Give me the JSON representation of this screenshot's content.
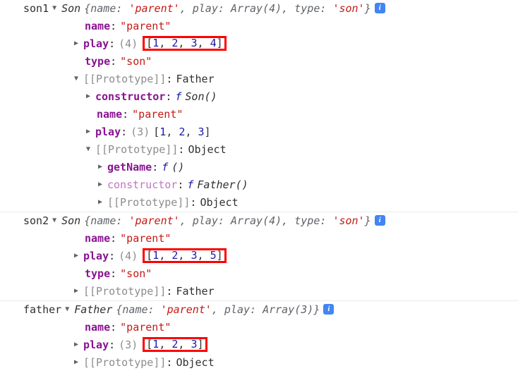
{
  "console": {
    "title": "devtools-console-object-inspector",
    "colors": {
      "key_own": "#881391",
      "key_proto": "#c176c1",
      "string": "#c41a16",
      "number": "#1a1aa6",
      "muted": "#8d8d8d",
      "highlight": "#ff0000",
      "info_badge": "#4285f4"
    },
    "icons": {
      "expanded": "▼",
      "collapsed": "▶",
      "info": "i"
    },
    "groups": [
      {
        "name": "son1-group",
        "variable": "son1",
        "header": {
          "arrow": "▼",
          "constructor": "Son",
          "preview_open": "{name: ",
          "preview_str1": "'parent'",
          "preview_mid": ", play: Array(4), type: ",
          "preview_str2": "'son'",
          "preview_close": "}",
          "info": "i"
        },
        "rows": [
          {
            "name": "row-name",
            "arrow": "",
            "indent": 2,
            "key": "name",
            "key_kind": "own",
            "value": "\"parent\"",
            "value_kind": "string"
          },
          {
            "name": "row-play",
            "arrow": "▶",
            "indent": 1,
            "key": "play",
            "key_kind": "own",
            "count": "(4)",
            "value_kind": "array",
            "highlight": true,
            "array_text": "[1, 2, 3, 4]",
            "array_items": [
              1,
              2,
              3,
              4
            ]
          },
          {
            "name": "row-type",
            "arrow": "",
            "indent": 2,
            "key": "type",
            "key_kind": "own",
            "value": "\"son\"",
            "value_kind": "string"
          },
          {
            "name": "row-prototype-father",
            "arrow": "▼",
            "indent": 1,
            "key": "[[Prototype]]",
            "key_kind": "internal",
            "value": "Father",
            "value_kind": "plain"
          },
          {
            "name": "row-constructor-son",
            "arrow": "▶",
            "indent": 3,
            "key": "constructor",
            "key_kind": "own",
            "value_kind": "function",
            "fn_marker": "f",
            "fn_name": "Son()"
          },
          {
            "name": "row-proto-name",
            "arrow": "",
            "indent": 4,
            "key": "name",
            "key_kind": "own",
            "value": "\"parent\"",
            "value_kind": "string"
          },
          {
            "name": "row-proto-play",
            "arrow": "▶",
            "indent": 3,
            "key": "play",
            "key_kind": "own",
            "count": "(3)",
            "value_kind": "array",
            "highlight": false,
            "array_text": "[1, 2, 3]",
            "array_items": [
              1,
              2,
              3
            ]
          },
          {
            "name": "row-prototype-object",
            "arrow": "▼",
            "indent": 3,
            "key": "[[Prototype]]",
            "key_kind": "internal",
            "value": "Object",
            "value_kind": "plain"
          },
          {
            "name": "row-getname",
            "arrow": "▶",
            "indent": 5,
            "key": "getName",
            "key_kind": "own",
            "value_kind": "function",
            "fn_marker": "f",
            "fn_name": "()"
          },
          {
            "name": "row-constructor-father",
            "arrow": "▶",
            "indent": 5,
            "key": "constructor",
            "key_kind": "proto",
            "value_kind": "function",
            "fn_marker": "f",
            "fn_name": "Father()"
          },
          {
            "name": "row-prototype-object-2",
            "arrow": "▶",
            "indent": 5,
            "key": "[[Prototype]]",
            "key_kind": "internal",
            "value": "Object",
            "value_kind": "plain"
          }
        ]
      },
      {
        "name": "son2-group",
        "variable": "son2",
        "header": {
          "arrow": "▼",
          "constructor": "Son",
          "preview_open": "{name: ",
          "preview_str1": "'parent'",
          "preview_mid": ", play: Array(4), type: ",
          "preview_str2": "'son'",
          "preview_close": "}",
          "info": "i"
        },
        "rows": [
          {
            "name": "row-name",
            "arrow": "",
            "indent": 2,
            "key": "name",
            "key_kind": "own",
            "value": "\"parent\"",
            "value_kind": "string"
          },
          {
            "name": "row-play",
            "arrow": "▶",
            "indent": 1,
            "key": "play",
            "key_kind": "own",
            "count": "(4)",
            "value_kind": "array",
            "highlight": true,
            "array_text": "[1, 2, 3, 5]",
            "array_items": [
              1,
              2,
              3,
              5
            ]
          },
          {
            "name": "row-type",
            "arrow": "",
            "indent": 2,
            "key": "type",
            "key_kind": "own",
            "value": "\"son\"",
            "value_kind": "string"
          },
          {
            "name": "row-prototype-father",
            "arrow": "▶",
            "indent": 1,
            "key": "[[Prototype]]",
            "key_kind": "internal",
            "value": "Father",
            "value_kind": "plain"
          }
        ]
      },
      {
        "name": "father-group",
        "variable": "father",
        "header": {
          "arrow": "▼",
          "constructor": "Father",
          "preview_open": "{name: ",
          "preview_str1": "'parent'",
          "preview_mid": ", play: Array(3)",
          "preview_str2": "",
          "preview_close": "}",
          "info": "i"
        },
        "rows": [
          {
            "name": "row-name",
            "arrow": "",
            "indent": 2,
            "key": "name",
            "key_kind": "own",
            "value": "\"parent\"",
            "value_kind": "string"
          },
          {
            "name": "row-play",
            "arrow": "▶",
            "indent": 1,
            "key": "play",
            "key_kind": "own",
            "count": "(3)",
            "value_kind": "array",
            "highlight": true,
            "highlight_offset": true,
            "array_text": "[1, 2, 3]",
            "array_items": [
              1,
              2,
              3
            ]
          },
          {
            "name": "row-prototype-object",
            "arrow": "▶",
            "indent": 1,
            "key": "[[Prototype]]",
            "key_kind": "internal",
            "value": "Object",
            "value_kind": "plain"
          }
        ]
      }
    ]
  }
}
